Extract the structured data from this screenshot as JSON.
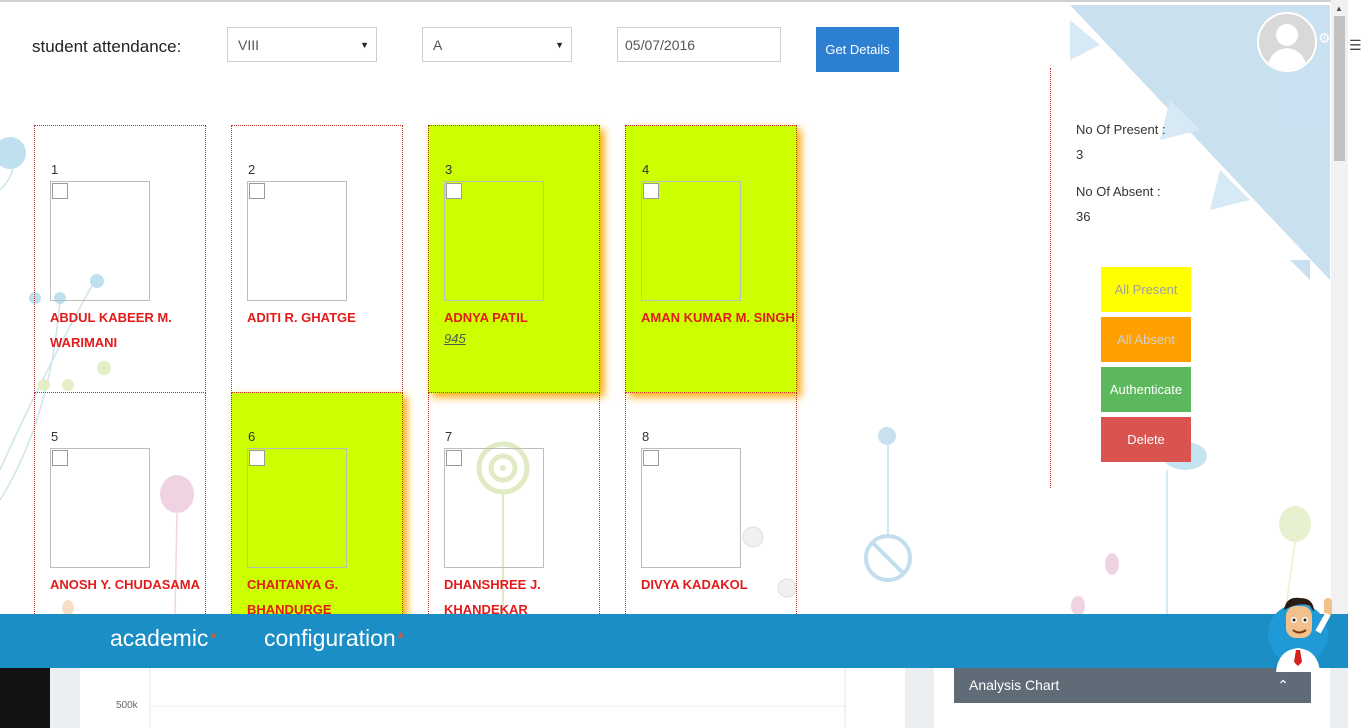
{
  "header": {
    "title": "student attendance:",
    "class_select": "VIII",
    "section_select": "A",
    "date": "05/07/2016",
    "get_details": "Get Details"
  },
  "stats": {
    "present_label": "No Of Present :",
    "present_value": "3",
    "absent_label": "No Of Absent :",
    "absent_value": "36"
  },
  "actions": {
    "all_present": "All Present",
    "all_absent": "All Absent",
    "authenticate": "Authenticate",
    "delete": "Delete"
  },
  "students": [
    {
      "num": "1",
      "name": "ABDUL KABEER M. WARIMANI",
      "roll": "",
      "present": false
    },
    {
      "num": "2",
      "name": "ADITI R. GHATGE",
      "roll": "",
      "present": false
    },
    {
      "num": "3",
      "name": "ADNYA PATIL",
      "roll": "945",
      "present": true
    },
    {
      "num": "4",
      "name": "AMAN KUMAR M. SINGH",
      "roll": "",
      "present": true
    },
    {
      "num": "5",
      "name": "ANOSH Y. CHUDASAMA",
      "roll": "",
      "present": false
    },
    {
      "num": "6",
      "name": "CHAITANYA G. BHANDURGE",
      "roll": "",
      "present": true
    },
    {
      "num": "7",
      "name": "DHANSHREE J. KHANDEKAR",
      "roll": "",
      "present": false
    },
    {
      "num": "8",
      "name": "DIVYA KADAKOL",
      "roll": "",
      "present": false
    }
  ],
  "nav": {
    "academic": "academic",
    "configuration": "configuration"
  },
  "bottom": {
    "axis_tick": "500k",
    "analysis_chart": "Analysis Chart"
  },
  "icons": {
    "gear": "gear-icon",
    "caret": "caret-down-icon",
    "chevron": "chevron-up-icon",
    "hamburger": "hamburger-icon"
  },
  "colors": {
    "present_card": "#ccff00",
    "present_glow": "#ffa800",
    "name_red": "#e31b1b",
    "nav_bar": "#1a8ec5",
    "btn_blue": "#2d7fd1",
    "btn_yellow": "#ffff00",
    "btn_orange": "#ff9f00",
    "btn_green": "#5cb85c",
    "btn_red": "#d9534f"
  }
}
